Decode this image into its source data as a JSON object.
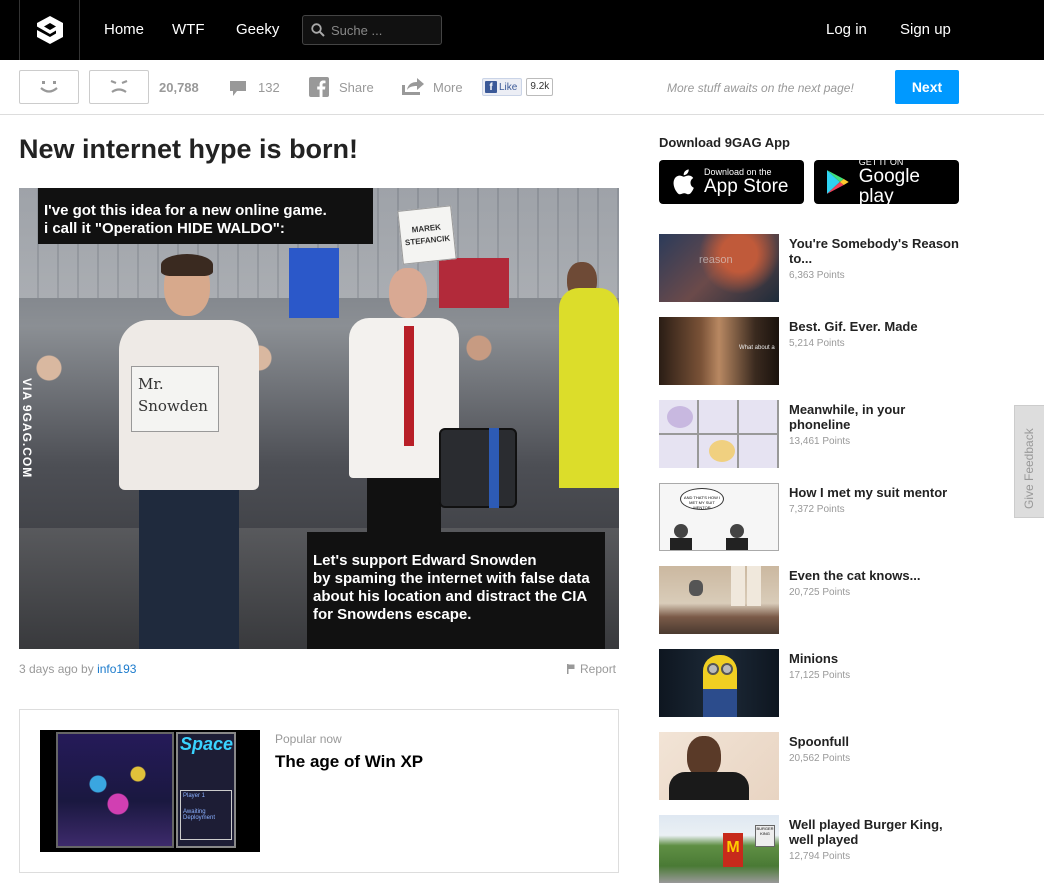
{
  "nav": {
    "home": "Home",
    "wtf": "WTF",
    "geeky": "Geeky",
    "search_placeholder": "Suche ...",
    "login": "Log in",
    "signup": "Sign up"
  },
  "actions": {
    "points": "20,788",
    "comments": "132",
    "share": "Share",
    "more": "More",
    "fb_like": "Like",
    "fb_count": "9.2k",
    "more_stuff": "More stuff awaits on the next page!",
    "next": "Next"
  },
  "post": {
    "title": "New internet hype is born!",
    "caption_top": "I've got this idea for a new online game.\ni call it \"Operation HIDE WALDO\":",
    "caption_bottom": "Let's support Edward Snowden\nby spaming the internet with false data\nabout his location and distract the CIA\nfor Snowdens escape.",
    "sign_left": "Mr. Snowden",
    "sign_right": "MAREK STEFANCIK",
    "watermark": "VIA 9GAG.COM",
    "time": "3 days ago by",
    "author": "info193",
    "report": "Report"
  },
  "popular": {
    "label": "Popular now",
    "title": "The age of Win XP",
    "thumb_logo": "Space",
    "thumb_player": "Player 1",
    "thumb_status": "Awaiting Deployment"
  },
  "sidebar": {
    "app_heading": "Download 9GAG App",
    "appstore_small": "Download on the",
    "appstore_big": "App Store",
    "google_small": "GET IT ON",
    "google_big": "Google play",
    "items": [
      {
        "title": "You're Somebody's Reason to...",
        "points": "6,363 Points",
        "thumb_text": "reason"
      },
      {
        "title": "Best. Gif. Ever. Made",
        "points": "5,214 Points",
        "thumb_text": "What about a"
      },
      {
        "title": "Meanwhile, in your phoneline",
        "points": "13,461 Points",
        "thumb_text": ""
      },
      {
        "title": "How I met my suit mentor",
        "points": "7,372 Points",
        "thumb_text": "AND THAT'S HOW I MET MY SUIT MENTOR"
      },
      {
        "title": "Even the cat knows...",
        "points": "20,725 Points",
        "thumb_text": ""
      },
      {
        "title": "Minions",
        "points": "17,125 Points",
        "thumb_text": ""
      },
      {
        "title": "Spoonfull",
        "points": "20,562 Points",
        "thumb_text": ""
      },
      {
        "title": "Well played Burger King, well played",
        "points": "12,794 Points",
        "thumb_text": "BURGER KING"
      }
    ]
  },
  "feedback": "Give Feedback",
  "colors": {
    "accent": "#0099ff",
    "topbar": "#000000",
    "link": "#1a7acc"
  }
}
